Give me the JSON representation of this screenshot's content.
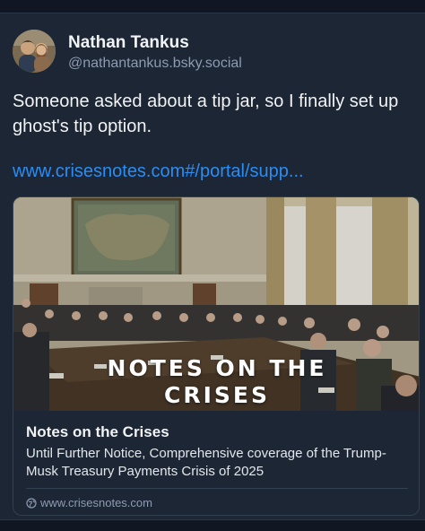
{
  "author": {
    "name": "Nathan Tankus",
    "handle": "@nathantankus.bsky.social"
  },
  "post": {
    "text": "Someone asked about a tip jar, so I finally set up ghost's tip option.",
    "link": "www.crisesnotes.com#/portal/supp..."
  },
  "embed": {
    "image_text_line1": "NOTES ON THE",
    "image_text_line2": "CRISES",
    "title": "Notes on the Crises",
    "description": "Until Further Notice, Comprehensive coverage of the Trump-Musk Treasury Payments Crisis of 2025",
    "domain": "www.crisesnotes.com",
    "domain_icon": "globe-icon"
  },
  "colors": {
    "background": "#101722",
    "card": "#1c2634",
    "link": "#2a8df4",
    "muted": "#8e9bb0"
  }
}
